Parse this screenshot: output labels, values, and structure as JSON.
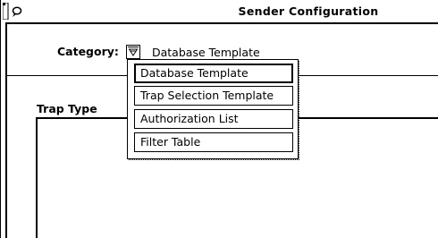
{
  "window": {
    "title": "Sender Configuration",
    "menu_icon": "window-menu-icon"
  },
  "category": {
    "label": "Category:",
    "selected_value": "Database Template",
    "button_icon": "abbreviated-menu-button-icon"
  },
  "trap_type": {
    "label": "Trap Type"
  },
  "category_menu": {
    "items": [
      {
        "label": "Database Template",
        "selected": true
      },
      {
        "label": "Trap Selection Template",
        "selected": false
      },
      {
        "label": "Authorization List",
        "selected": false
      },
      {
        "label": "Filter Table",
        "selected": false
      }
    ]
  }
}
